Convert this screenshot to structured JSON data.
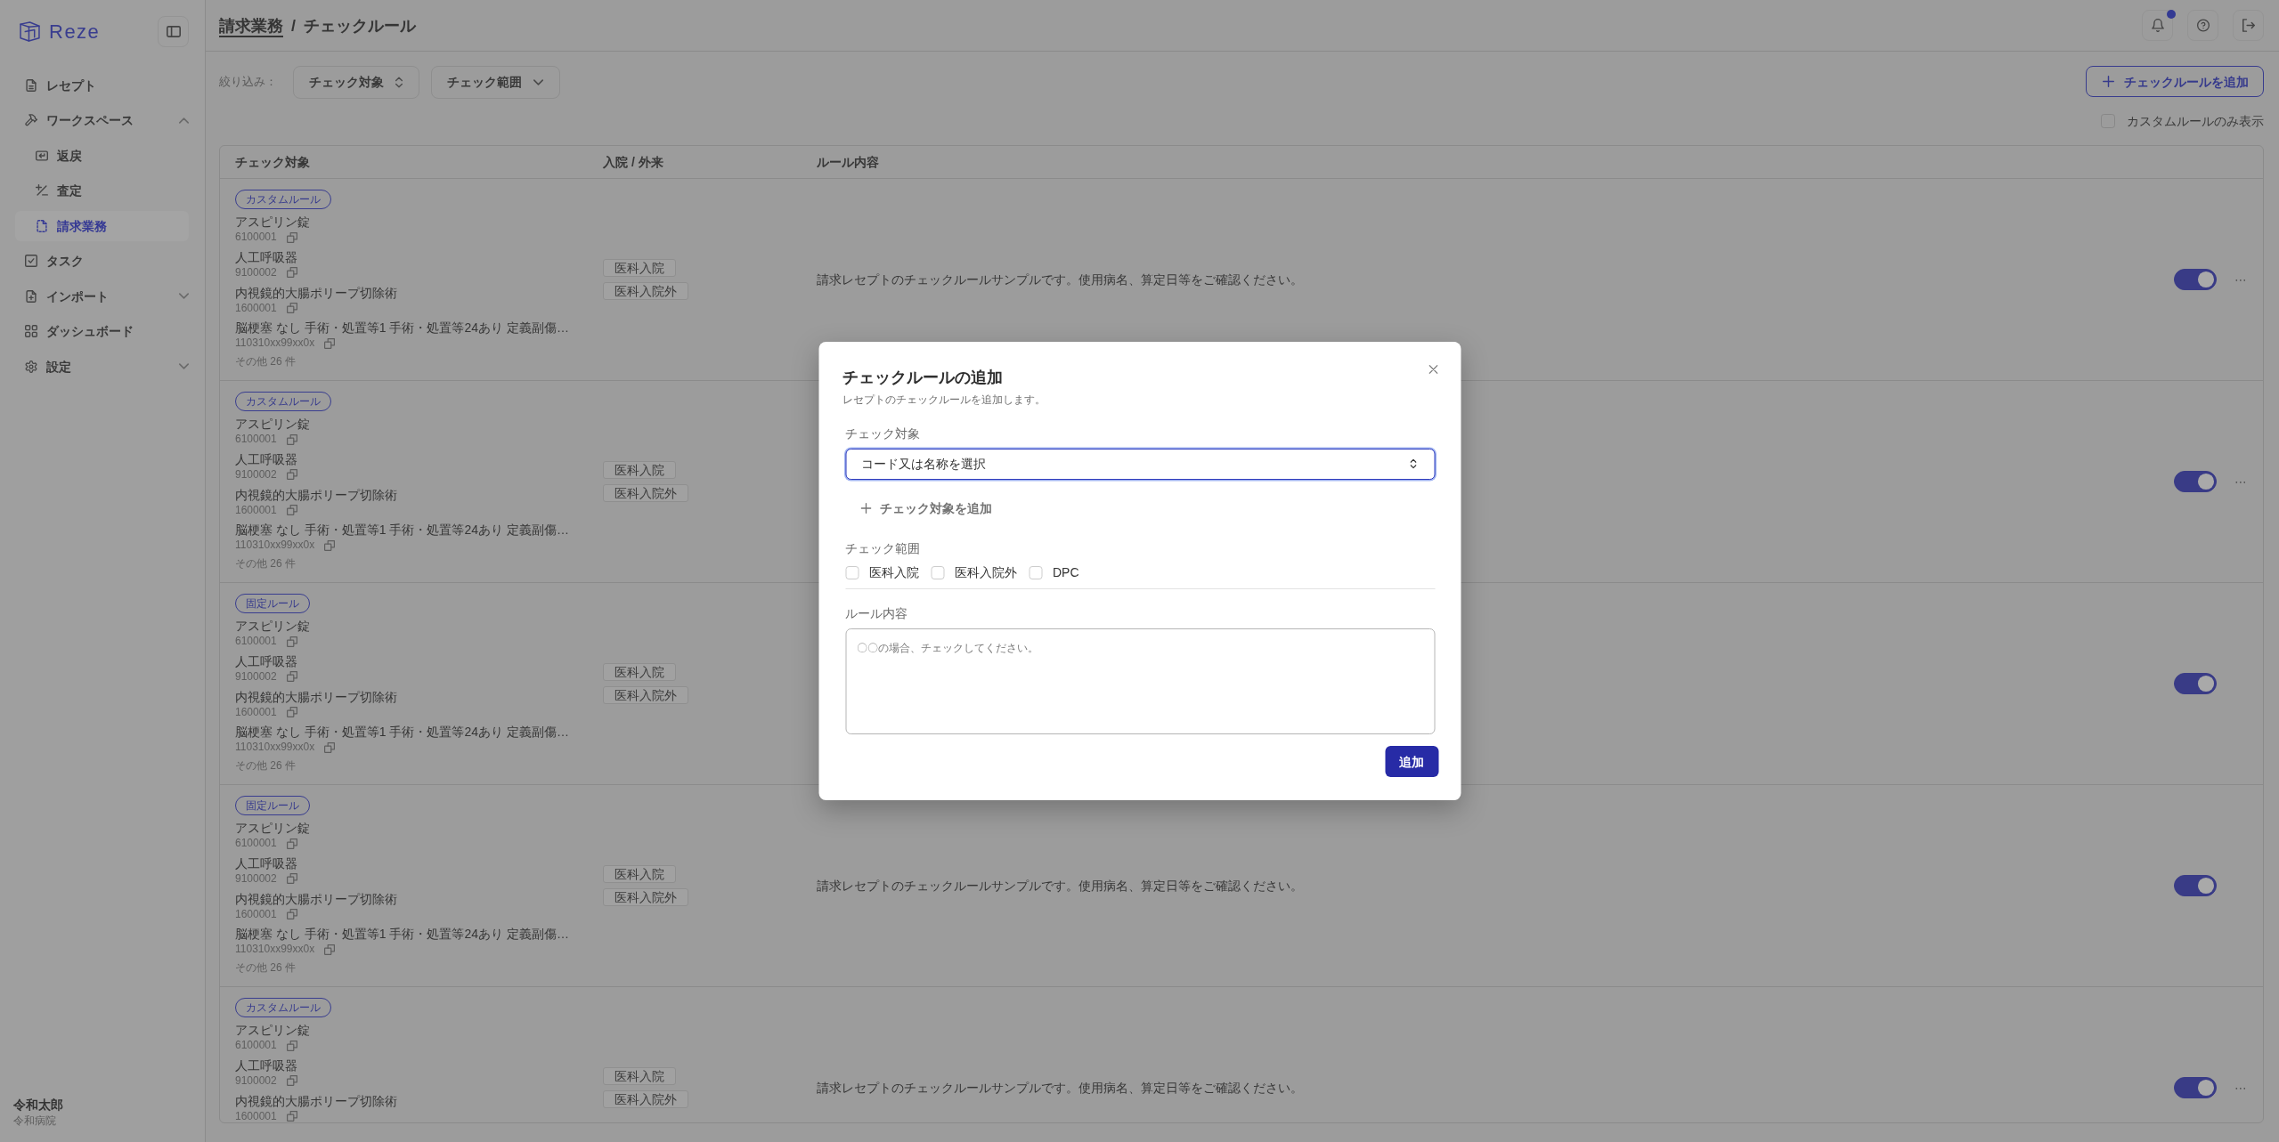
{
  "sidebar": {
    "brand": "Reze",
    "items": [
      {
        "label": "レセプト",
        "kind": "link",
        "selected": false
      },
      {
        "label": "ワークスペース",
        "kind": "group",
        "expanded": true,
        "selected": false,
        "children": [
          {
            "label": "返戻",
            "selected": false
          },
          {
            "label": "査定",
            "selected": false
          },
          {
            "label": "請求業務",
            "selected": true
          }
        ]
      },
      {
        "label": "タスク",
        "kind": "link",
        "selected": false
      },
      {
        "label": "インポート",
        "kind": "group",
        "expanded": false,
        "selected": false
      },
      {
        "label": "ダッシュボード",
        "kind": "link",
        "selected": false
      },
      {
        "label": "設定",
        "kind": "group",
        "expanded": false,
        "selected": false
      }
    ],
    "user": {
      "name": "令和太郎",
      "organization": "令和病院"
    }
  },
  "header": {
    "breadcrumb": [
      {
        "label": "請求業務",
        "kind": "link"
      },
      {
        "label": "チェックルール",
        "kind": "current"
      }
    ],
    "separator": "/",
    "actions": [
      {
        "notification_dot": true
      },
      {
        "notification_dot": false
      },
      {
        "notification_dot": false
      }
    ]
  },
  "toolbar": {
    "filter_label": "絞り込み：",
    "filters": [
      "チェック対象",
      "チェック範囲"
    ],
    "add_button": "チェックルールを追加",
    "custom_only": {
      "label": "カスタムルールのみ表示",
      "checked": false
    }
  },
  "table": {
    "columns": [
      "チェック対象",
      "入院 / 外来",
      "ルール内容"
    ],
    "rows": [
      {
        "rule_type": "カスタムルール",
        "targets": [
          {
            "name": "アスピリン錠",
            "code": "6100001"
          },
          {
            "name": "人工呼吸器",
            "code": "9100002"
          },
          {
            "name": "内視鏡的大腸ポリープ切除術",
            "code": "1600001"
          },
          {
            "name": "脳梗塞 なし 手術・処置等1 手術・処置等24あり 定義副傷…",
            "code": "110310xx99xx0x"
          }
        ],
        "more": "その他 26 件",
        "settings": [
          "医科入院",
          "医科入院外"
        ],
        "rule": "請求レセプトのチェックルールサンプルです。使用病名、算定日等をご確認ください。",
        "enabled": true,
        "menu": "⋯"
      },
      {
        "rule_type": "カスタムルール",
        "targets": [
          {
            "name": "アスピリン錠",
            "code": "6100001"
          },
          {
            "name": "人工呼吸器",
            "code": "9100002"
          },
          {
            "name": "内視鏡的大腸ポリープ切除術",
            "code": "1600001"
          },
          {
            "name": "脳梗塞 なし 手術・処置等1 手術・処置等24あり 定義副傷…",
            "code": "110310xx99xx0x"
          }
        ],
        "more": "その他 26 件",
        "settings": [
          "医科入院",
          "医科入院外"
        ],
        "enabled": true,
        "menu": "⋯"
      },
      {
        "rule_type": "固定ルール",
        "targets": [
          {
            "name": "アスピリン錠",
            "code": "6100001"
          },
          {
            "name": "人工呼吸器",
            "code": "9100002"
          },
          {
            "name": "内視鏡的大腸ポリープ切除術",
            "code": "1600001"
          },
          {
            "name": "脳梗塞 なし 手術・処置等1 手術・処置等24あり 定義副傷…",
            "code": "110310xx99xx0x"
          }
        ],
        "more": "その他 26 件",
        "settings": [
          "医科入院",
          "医科入院外"
        ],
        "enabled": true
      },
      {
        "rule_type": "固定ルール",
        "targets": [
          {
            "name": "アスピリン錠",
            "code": "6100001"
          },
          {
            "name": "人工呼吸器",
            "code": "9100002"
          },
          {
            "name": "内視鏡的大腸ポリープ切除術",
            "code": "1600001"
          },
          {
            "name": "脳梗塞 なし 手術・処置等1 手術・処置等24あり 定義副傷…",
            "code": "110310xx99xx0x"
          }
        ],
        "more": "その他 26 件",
        "settings": [
          "医科入院",
          "医科入院外"
        ],
        "rule": "請求レセプトのチェックルールサンプルです。使用病名、算定日等をご確認ください。",
        "enabled": true
      },
      {
        "rule_type": "カスタムルール",
        "targets": [
          {
            "name": "アスピリン錠",
            "code": "6100001"
          },
          {
            "name": "人工呼吸器",
            "code": "9100002"
          },
          {
            "name": "内視鏡的大腸ポリープ切除術",
            "code": "1600001"
          }
        ],
        "settings": [
          "医科入院",
          "医科入院外"
        ],
        "rule": "請求レセプトのチェックルールサンプルです。使用病名、算定日等をご確認ください。",
        "enabled": true,
        "menu": "⋯"
      }
    ]
  },
  "dialog": {
    "title": "チェックルールの追加",
    "description": "レセプトのチェックルールを追加します。",
    "target": {
      "label": "チェック対象",
      "placeholder": "コード又は名称を選択",
      "focused": true
    },
    "add_target": "チェック対象を追加",
    "range": {
      "label": "チェック範囲",
      "options": [
        {
          "label": "医科入院",
          "checked": false
        },
        {
          "label": "医科入院外",
          "checked": false
        },
        {
          "label": "DPC",
          "checked": false
        }
      ]
    },
    "rule": {
      "label": "ルール内容",
      "placeholder": "〇〇の場合、チェックしてください。"
    },
    "submit": "追加"
  }
}
